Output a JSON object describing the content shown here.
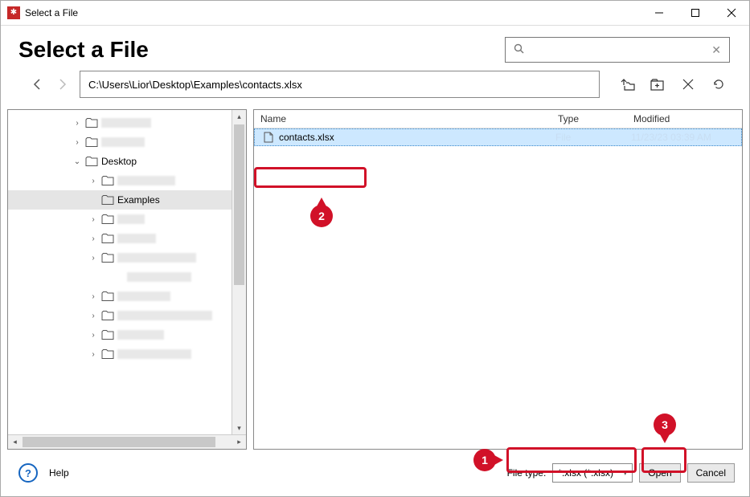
{
  "titlebar": {
    "title": "Select a File"
  },
  "heading": "Select a File",
  "search": {
    "placeholder": ""
  },
  "nav": {
    "path": "C:\\Users\\Lior\\Desktop\\Examples\\contacts.xlsx"
  },
  "tree": {
    "items": [
      {
        "indent": 80,
        "chev": "›",
        "label": null,
        "blur_w": 62
      },
      {
        "indent": 80,
        "chev": "›",
        "label": null,
        "blur_w": 54
      },
      {
        "indent": 80,
        "chev": "v",
        "label": "Desktop"
      },
      {
        "indent": 100,
        "chev": "›",
        "label": null,
        "blur_w": 72
      },
      {
        "indent": 100,
        "chev": "",
        "label": "Examples",
        "selected": true
      },
      {
        "indent": 100,
        "chev": "›",
        "label": null,
        "blur_w": 34
      },
      {
        "indent": 100,
        "chev": "›",
        "label": null,
        "blur_w": 48
      },
      {
        "indent": 100,
        "chev": "›",
        "label": null,
        "blur_w": 98
      },
      {
        "indent": 132,
        "chev": "",
        "label": null,
        "blur_w": 80,
        "no_folder": true
      },
      {
        "indent": 100,
        "chev": "›",
        "label": null,
        "blur_w": 66
      },
      {
        "indent": 100,
        "chev": "›",
        "label": null,
        "blur_w": 118
      },
      {
        "indent": 100,
        "chev": "›",
        "label": null,
        "blur_w": 58
      },
      {
        "indent": 100,
        "chev": "›",
        "label": null,
        "blur_w": 92
      }
    ]
  },
  "columns": {
    "name": "Name",
    "type": "Type",
    "modified": "Modified"
  },
  "files": [
    {
      "name": "contacts.xlsx",
      "type": "File",
      "modified": "11/23/23 03:39 AM",
      "selected": true
    }
  ],
  "footer": {
    "help": "Help",
    "filetype_label": "File type:",
    "filetype_value": "*.xlsx (*.xlsx)",
    "open": "Open",
    "cancel": "Cancel"
  },
  "annotations": {
    "a1": "1",
    "a2": "2",
    "a3": "3"
  }
}
